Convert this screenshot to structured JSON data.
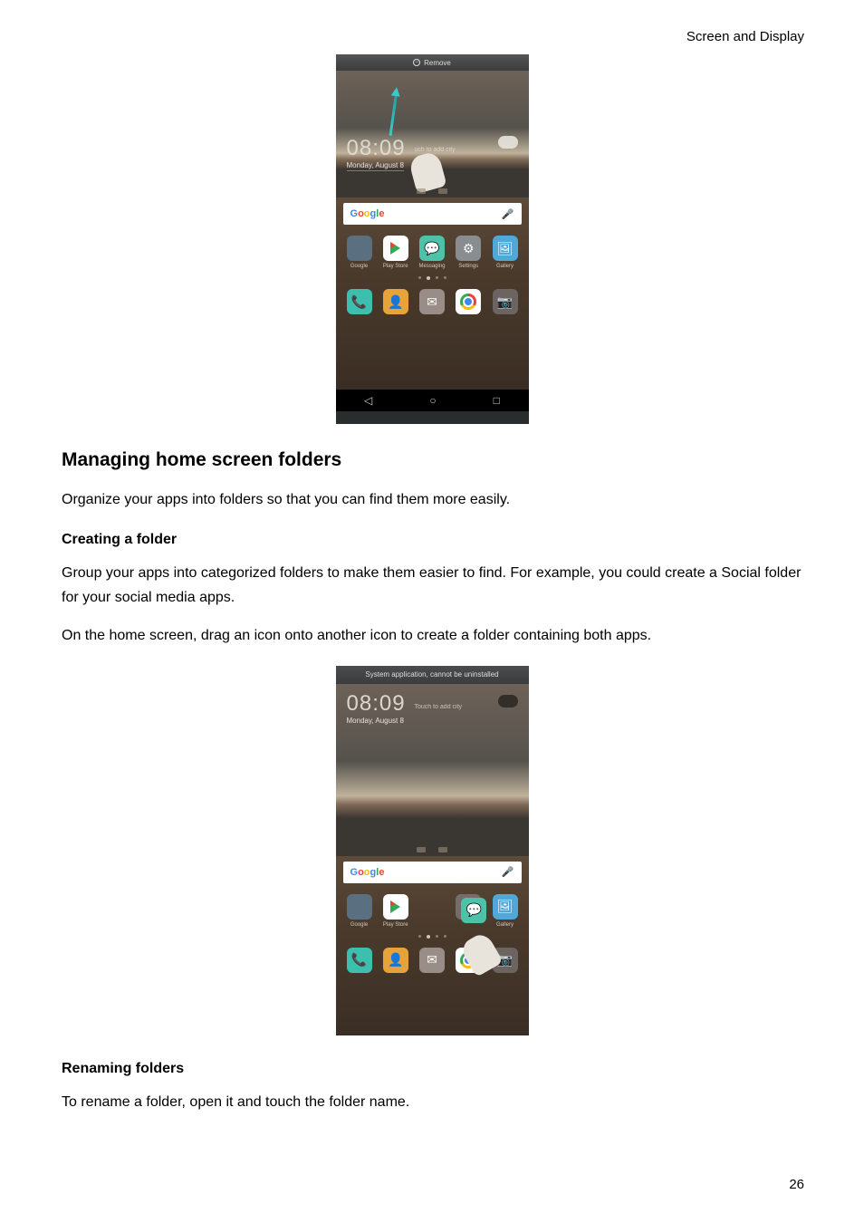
{
  "header": "Screen and Display",
  "page_number": "26",
  "phone1": {
    "remove_label": "Remove",
    "clock": "08:09",
    "clock_hint": "uch to add city",
    "date": "Monday, August 8",
    "search_brand": "Google",
    "apps": [
      "Google",
      "Play Store",
      "Messaging",
      "Settings",
      "Gallery"
    ]
  },
  "phone2": {
    "toast": "System application, cannot be uninstalled",
    "clock": "08:09",
    "clock_hint": "Touch to add city",
    "date": "Monday, August 8",
    "search_brand": "Google",
    "apps": [
      "Google",
      "Play Store",
      "",
      "",
      "Gallery"
    ]
  },
  "section": {
    "h2": "Managing home screen folders",
    "p1": "Organize your apps into folders so that you can find them more easily.",
    "h3a": "Creating a folder",
    "p2": "Group your apps into categorized folders to make them easier to find. For example, you could create a Social folder for your social media apps.",
    "p3": "On the home screen, drag an icon onto another icon to create a folder containing both apps.",
    "h3b": "Renaming folders",
    "p4": "To rename a folder, open it and touch the folder name."
  }
}
